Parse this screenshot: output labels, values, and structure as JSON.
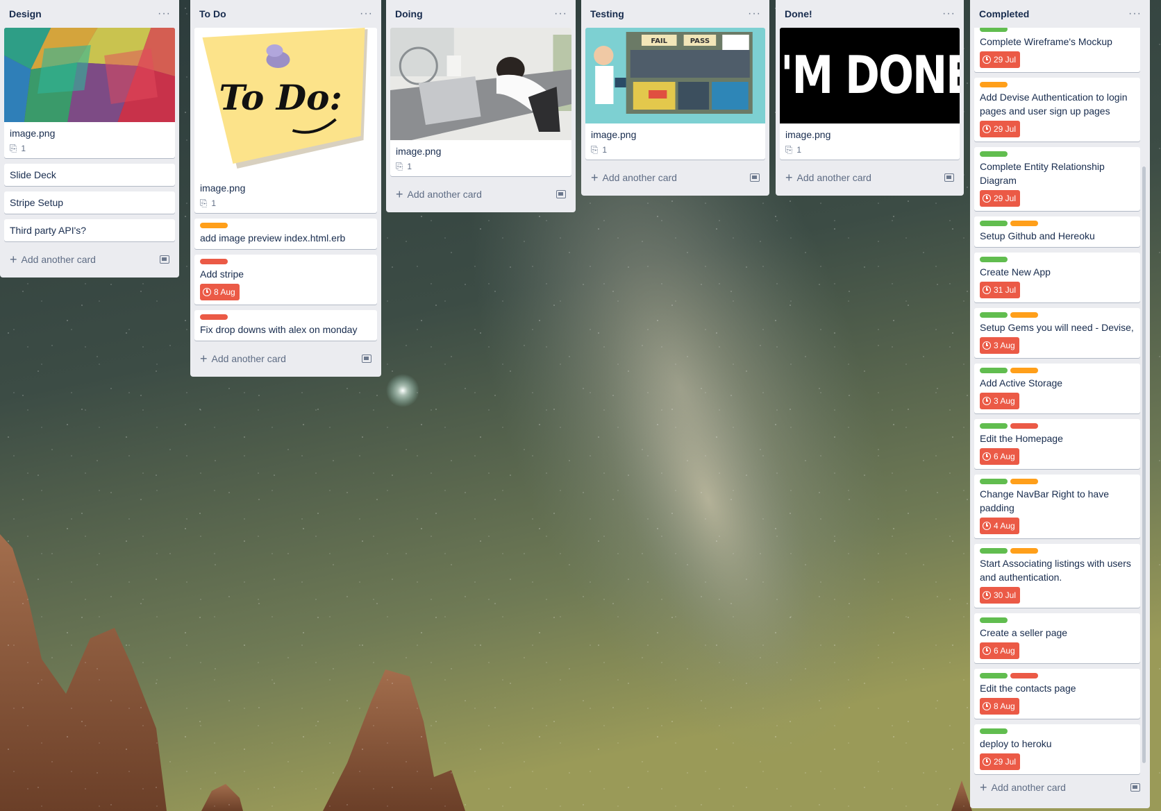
{
  "lists": {
    "design": {
      "title": "Design",
      "cover_card": {
        "title": "image.png",
        "attachments": "1"
      },
      "cards": [
        "Slide Deck",
        "Stripe Setup",
        "Third party API's?"
      ],
      "add_label": "Add another card"
    },
    "todo": {
      "title": "To Do",
      "cover_card": {
        "title": "image.png",
        "attachments": "1",
        "cover_text": "To Do:"
      },
      "cards": [
        {
          "title": "add image preview index.html.erb"
        },
        {
          "title": "Add stripe",
          "due": "8 Aug"
        },
        {
          "title": "Fix drop downs with alex on monday"
        }
      ],
      "add_label": "Add another card"
    },
    "doing": {
      "title": "Doing",
      "cover_card": {
        "title": "image.png",
        "attachments": "1"
      },
      "add_label": "Add another card"
    },
    "testing": {
      "title": "Testing",
      "cover_card": {
        "title": "image.png",
        "attachments": "1",
        "cover_words": [
          "FAIL",
          "PASS"
        ]
      },
      "add_label": "Add another card"
    },
    "done": {
      "title": "Done!",
      "cover_card": {
        "title": "image.png",
        "attachments": "1",
        "cover_text": "I'M DONE"
      },
      "add_label": "Add another card"
    },
    "completed": {
      "title": "Completed",
      "cards": [
        {
          "title": "Complete Wireframe's Mockup",
          "due": "29 Jul"
        },
        {
          "title": "Add Devise Authentication to login pages and user sign up pages",
          "due": "29 Jul"
        },
        {
          "title": "Complete Entity Relationship Diagram",
          "due": "29 Jul"
        },
        {
          "title": "Setup Github and Hereoku"
        },
        {
          "title": "Create New App",
          "due": "31 Jul"
        },
        {
          "title": "Setup Gems you will need - Devise,",
          "due": "3 Aug"
        },
        {
          "title": "Add Active Storage",
          "due": "3 Aug"
        },
        {
          "title": "Edit the Homepage",
          "due": "6 Aug"
        },
        {
          "title": "Change NavBar Right to have padding",
          "due": "4 Aug"
        },
        {
          "title": "Start Associating listings with users and authentication.",
          "due": "30 Jul"
        },
        {
          "title": "Create a seller page",
          "due": "6 Aug"
        },
        {
          "title": "Edit the contacts page",
          "due": "8 Aug"
        },
        {
          "title": "deploy to heroku",
          "due": "29 Jul"
        }
      ],
      "add_label": "Add another card"
    }
  },
  "colors": {
    "list_bg": "#ebecf0",
    "label_green": "#61bd4f",
    "label_orange": "#ff9f1a",
    "label_red": "#eb5a46",
    "due_overdue": "#eb5a46"
  },
  "icons": {
    "menu": "ellipsis-icon",
    "attachment": "paperclip-icon",
    "add": "plus-icon",
    "template": "card-template-icon",
    "due": "clock-icon"
  },
  "glyphs": {
    "menu": "···",
    "plus": "+",
    "clip": "⎘"
  }
}
